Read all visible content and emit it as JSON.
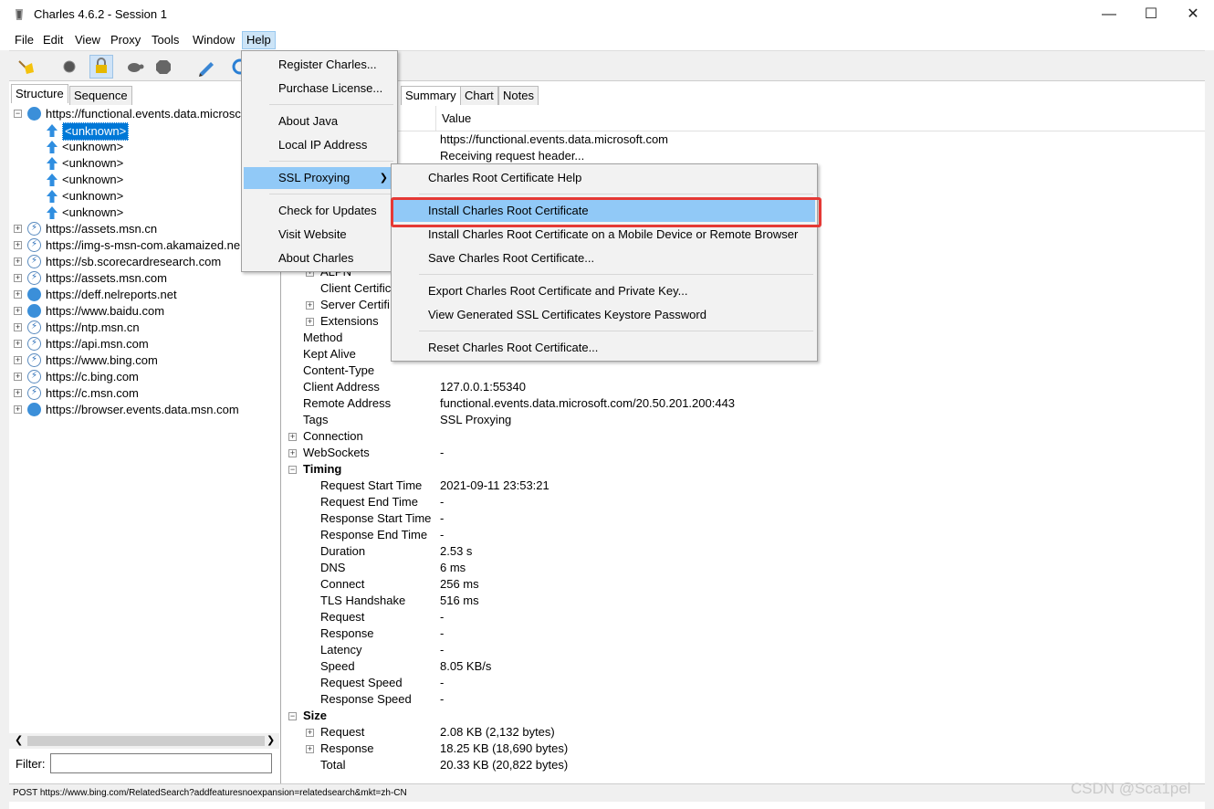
{
  "window": {
    "title": "Charles 4.6.2 - Session 1"
  },
  "menubar": [
    "File",
    "Edit",
    "View",
    "Proxy",
    "Tools",
    "Window",
    "Help"
  ],
  "left_tabs": [
    "Structure",
    "Sequence"
  ],
  "right_tabs": [
    "Summary",
    "Chart",
    "Notes"
  ],
  "tree": {
    "root": "https://functional.events.data.microsc",
    "children": [
      "<unknown>",
      "<unknown>",
      "<unknown>",
      "<unknown>",
      "<unknown>",
      "<unknown>"
    ],
    "hosts": [
      "https://assets.msn.cn",
      "https://img-s-msn-com.akamaized.ne",
      "https://sb.scorecardresearch.com",
      "https://assets.msn.com",
      "https://deff.nelreports.net",
      "https://www.baidu.com",
      "https://ntp.msn.cn",
      "https://api.msn.com",
      "https://www.bing.com",
      "https://c.bing.com",
      "https://c.msn.com",
      "https://browser.events.data.msn.com"
    ]
  },
  "filter_label": "Filter:",
  "details": {
    "value_header": "Value",
    "url_value": "https://functional.events.data.microsoft.com",
    "status_value": "Receiving request header...",
    "alpn_label": "ALPN",
    "client_cert_label": "Client Certific",
    "server_cert_label": "Server Certifi",
    "extensions_label": "Extensions",
    "rows": [
      {
        "label": "Method",
        "value": ""
      },
      {
        "label": "Kept Alive",
        "value": ""
      },
      {
        "label": "Content-Type",
        "value": ""
      },
      {
        "label": "Client Address",
        "value": "127.0.0.1:55340"
      },
      {
        "label": "Remote Address",
        "value": "functional.events.data.microsoft.com/20.50.201.200:443"
      },
      {
        "label": "Tags",
        "value": "SSL Proxying"
      },
      {
        "label": "Connection",
        "value": ""
      },
      {
        "label": "WebSockets",
        "value": "-"
      }
    ],
    "timing_header": "Timing",
    "timing": [
      {
        "label": "Request Start Time",
        "value": "2021-09-11 23:53:21"
      },
      {
        "label": "Request End Time",
        "value": "-"
      },
      {
        "label": "Response Start Time",
        "value": "-"
      },
      {
        "label": "Response End Time",
        "value": "-"
      },
      {
        "label": "Duration",
        "value": "2.53 s"
      },
      {
        "label": "DNS",
        "value": "6 ms"
      },
      {
        "label": "Connect",
        "value": "256 ms"
      },
      {
        "label": "TLS Handshake",
        "value": "516 ms"
      },
      {
        "label": "Request",
        "value": "-"
      },
      {
        "label": "Response",
        "value": "-"
      },
      {
        "label": "Latency",
        "value": "-"
      },
      {
        "label": "Speed",
        "value": "8.05 KB/s"
      },
      {
        "label": "Request Speed",
        "value": "-"
      },
      {
        "label": "Response Speed",
        "value": "-"
      }
    ],
    "size_header": "Size",
    "size": [
      {
        "label": "Request",
        "value": "2.08 KB (2,132 bytes)"
      },
      {
        "label": "Response",
        "value": "18.25 KB (18,690 bytes)"
      },
      {
        "label": "Total",
        "value": "20.33 KB (20,822 bytes)"
      }
    ]
  },
  "help_menu": {
    "register": "Register Charles...",
    "purchase": "Purchase License...",
    "about_java": "About Java",
    "local_ip": "Local IP Address",
    "ssl_proxying": "SSL Proxying",
    "check_updates": "Check for Updates",
    "visit_website": "Visit Website",
    "about_charles": "About Charles"
  },
  "ssl_menu": {
    "root_help": "Charles Root Certificate Help",
    "install_root": "Install Charles Root Certificate",
    "install_mobile": "Install Charles Root Certificate on a Mobile Device or Remote Browser",
    "save_root": "Save Charles Root Certificate...",
    "export_root": "Export Charles Root Certificate and Private Key...",
    "view_keystore": "View Generated SSL Certificates Keystore Password",
    "reset_root": "Reset Charles Root Certificate..."
  },
  "statusbar": "POST https://www.bing.com/RelatedSearch?addfeaturesnoexpansion=relatedsearch&mkt=zh-CN",
  "watermark": "CSDN @Sca1pel"
}
